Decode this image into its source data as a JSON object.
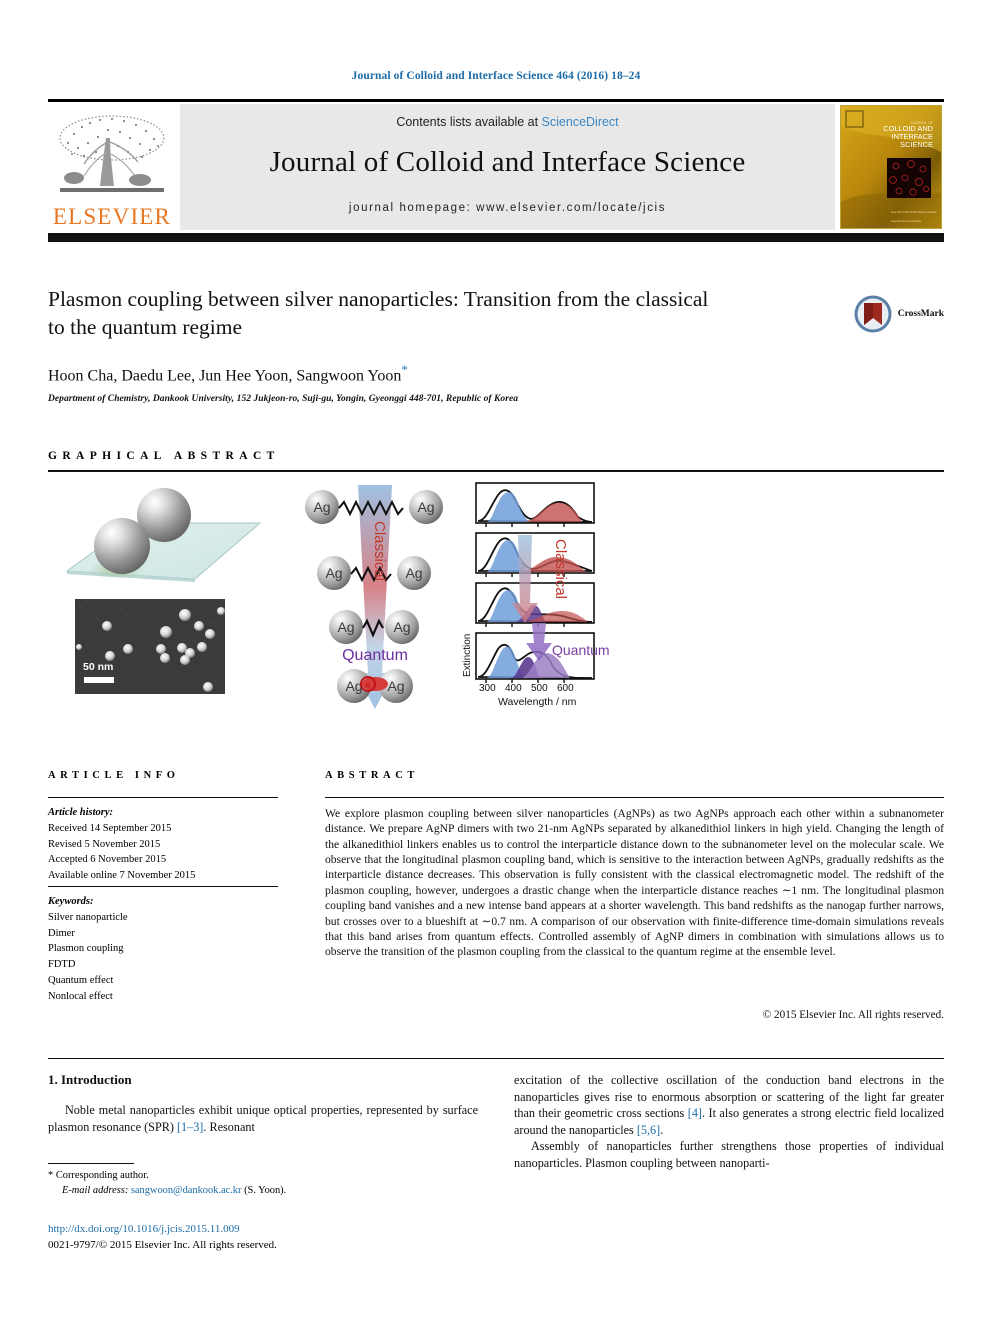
{
  "running_head": "Journal of Colloid and Interface Science 464 (2016) 18–24",
  "masthead": {
    "contents_prefix": "Contents lists available at ",
    "sciencedirect": "ScienceDirect",
    "journal_title": "Journal of Colloid and Interface Science",
    "homepage": "journal homepage: www.elsevier.com/locate/jcis",
    "publisher_logo_text": "ELSEVIER",
    "cover_title_line1": "JOURNAL OF",
    "cover_title_line2": "COLLOID AND",
    "cover_title_line3": "INTERFACE",
    "cover_title_line4": "SCIENCE",
    "colors": {
      "link": "#3b87c4",
      "elsevier_orange": "#E87722",
      "masthead_grey": "#e8e8e8",
      "cover_gold": "#c79a12"
    }
  },
  "article": {
    "title": "Plasmon coupling between silver nanoparticles: Transition from the classical to the quantum regime",
    "authors": "Hoon Cha, Daedu Lee, Jun Hee Yoon, Sangwoon Yoon",
    "corresponding_marker": "*",
    "affiliation": "Department of Chemistry, Dankook University, 152 Jukjeon-ro, Suji-gu, Yongin, Gyeonggi 448-701, Republic of Korea",
    "crossmark_label": "CrossMark"
  },
  "graphical_abstract": {
    "heading": "GRAPHICAL ABSTRACT",
    "tem_scale_label": "50 nm",
    "scheme": {
      "particle_label": "Ag",
      "classical_label": "Classical",
      "quantum_label": "Quantum",
      "electron_label": "e"
    }
  },
  "chart_data": {
    "type": "line",
    "title": "",
    "xlabel": "Wavelength / nm",
    "ylabel": "Extinction",
    "xlim": [
      300,
      650
    ],
    "xticks": [
      300,
      400,
      500,
      600
    ],
    "xticklabels": [
      "300",
      "400",
      "500",
      "600"
    ],
    "grid": false,
    "legend": null,
    "panels": [
      {
        "name": "panel-1-longest-linker",
        "components": [
          {
            "name": "transverse-band",
            "color": "#6f9ed8",
            "peak_nm": 395,
            "peak_height": 0.78,
            "width_nm": 42
          },
          {
            "name": "longitudinal-band",
            "color": "#c0504d",
            "peak_nm": 505,
            "peak_height": 0.4,
            "width_nm": 62
          }
        ]
      },
      {
        "name": "panel-2",
        "components": [
          {
            "name": "transverse-band",
            "color": "#6f9ed8",
            "peak_nm": 395,
            "peak_height": 0.82,
            "width_nm": 40
          },
          {
            "name": "longitudinal-band",
            "color": "#c0504d",
            "peak_nm": 480,
            "peak_height": 0.34,
            "width_nm": 70
          }
        ]
      },
      {
        "name": "panel-3",
        "components": [
          {
            "name": "transverse-band",
            "color": "#6f9ed8",
            "peak_nm": 395,
            "peak_height": 0.84,
            "width_nm": 40
          },
          {
            "name": "quantum-band",
            "color": "#5b3a8e",
            "peak_nm": 440,
            "peak_height": 0.3,
            "width_nm": 30
          },
          {
            "name": "longitudinal-band",
            "color": "#c0504d",
            "peak_nm": 470,
            "peak_height": 0.3,
            "width_nm": 75
          }
        ]
      },
      {
        "name": "panel-4-shortest-linker",
        "components": [
          {
            "name": "transverse-band",
            "color": "#6f9ed8",
            "peak_nm": 392,
            "peak_height": 0.72,
            "width_nm": 36
          },
          {
            "name": "quantum-band",
            "color": "#6b4a9c",
            "peak_nm": 430,
            "peak_height": 0.5,
            "width_nm": 26
          },
          {
            "name": "quantum-band-broad",
            "color": "#9b7fc4",
            "peak_nm": 465,
            "peak_height": 0.62,
            "width_nm": 46
          }
        ]
      }
    ],
    "annotations": [
      {
        "text": "Classical",
        "color": "#c0392b",
        "orientation": "vertical"
      },
      {
        "text": "Quantum",
        "color": "#7b3fa0",
        "orientation": "horizontal"
      }
    ]
  },
  "article_info": {
    "heading": "ARTICLE INFO",
    "history_label": "Article history:",
    "history": [
      "Received 14 September 2015",
      "Revised 5 November 2015",
      "Accepted 6 November 2015",
      "Available online 7 November 2015"
    ],
    "keywords_label": "Keywords:",
    "keywords": [
      "Silver nanoparticle",
      "Dimer",
      "Plasmon coupling",
      "FDTD",
      "Quantum effect",
      "Nonlocal effect"
    ]
  },
  "abstract": {
    "heading": "ABSTRACT",
    "text": "We explore plasmon coupling between silver nanoparticles (AgNPs) as two AgNPs approach each other within a subnanometer distance. We prepare AgNP dimers with two 21-nm AgNPs separated by alkanedithiol linkers in high yield. Changing the length of the alkanedithiol linkers enables us to control the interparticle distance down to the subnanometer level on the molecular scale. We observe that the longitudinal plasmon coupling band, which is sensitive to the interaction between AgNPs, gradually redshifts as the interparticle distance decreases. This observation is fully consistent with the classical electromagnetic model. The redshift of the plasmon coupling, however, undergoes a drastic change when the interparticle distance reaches ∼1 nm. The longitudinal plasmon coupling band vanishes and a new intense band appears at a shorter wavelength. This band redshifts as the nanogap further narrows, but crosses over to a blueshift at ∼0.7 nm. A comparison of our observation with finite-difference time-domain simulations reveals that this band arises from quantum effects. Controlled assembly of AgNP dimers in combination with simulations allows us to observe the transition of the plasmon coupling from the classical to the quantum regime at the ensemble level.",
    "copyright": "© 2015 Elsevier Inc. All rights reserved."
  },
  "body": {
    "section_title": "1. Introduction",
    "left_paragraph": "Noble metal nanoparticles exhibit unique optical properties, represented by surface plasmon resonance (SPR)",
    "left_ref": "[1–3]",
    "left_paragraph_tail": ". Resonant",
    "right_paragraph_1": "excitation of the collective oscillation of the conduction band electrons in the nanoparticles gives rise to enormous absorption or scattering of the light far greater than their geometric cross sections",
    "right_ref_1": "[4]",
    "right_paragraph_1b": ". It also generates a strong electric field localized around the nanoparticles",
    "right_ref_2": "[5,6]",
    "right_paragraph_1c": ".",
    "right_paragraph_2": "Assembly of nanoparticles further strengthens those properties of individual nanoparticles. Plasmon coupling between nanoparti-"
  },
  "footer": {
    "corresponding_marker": "*",
    "corresponding_text": "Corresponding author.",
    "email_label": "E-mail address:",
    "email": "sangwoon@dankook.ac.kr",
    "email_suffix": "(S. Yoon).",
    "doi": "http://dx.doi.org/10.1016/j.jcis.2015.11.009",
    "issn_line": "0021-9797/© 2015 Elsevier Inc. All rights reserved."
  }
}
